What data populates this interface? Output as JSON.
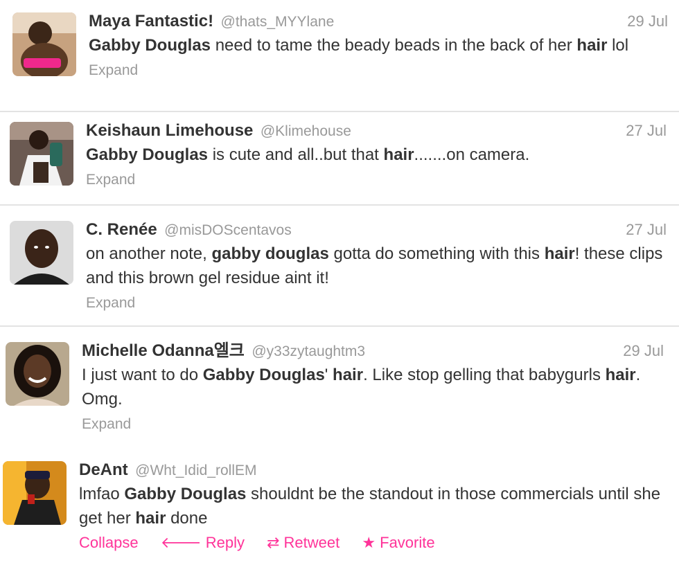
{
  "tweets": [
    {
      "name": "Maya Fantastic!",
      "handle": "@thats_MYYlane",
      "date": "29 Jul",
      "text_parts": [
        {
          "t": "Gabby Douglas",
          "b": true
        },
        {
          "t": " need to tame the beady beads in the back of her ",
          "b": false
        },
        {
          "t": "hair",
          "b": true
        },
        {
          "t": " lol",
          "b": false
        }
      ],
      "expand": "Expand"
    },
    {
      "name": "Keishaun Limehouse",
      "handle": "@Klimehouse",
      "date": "27 Jul",
      "text_parts": [
        {
          "t": "Gabby Douglas",
          "b": true
        },
        {
          "t": " is cute and all..but that ",
          "b": false
        },
        {
          "t": "hair",
          "b": true
        },
        {
          "t": ".......on camera.",
          "b": false
        }
      ],
      "expand": "Expand"
    },
    {
      "name": "C. Renée",
      "handle": "@misDOScentavos",
      "date": "27 Jul",
      "text_parts": [
        {
          "t": "on another note, ",
          "b": false
        },
        {
          "t": "gabby douglas",
          "b": true
        },
        {
          "t": " gotta do something with this ",
          "b": false
        },
        {
          "t": "hair",
          "b": true
        },
        {
          "t": "! these clips and this brown gel residue aint it!",
          "b": false
        }
      ],
      "expand": "Expand"
    },
    {
      "name": "Michelle Odanna엘크",
      "handle": "@y33zytaughtm3",
      "date": "29 Jul",
      "text_parts": [
        {
          "t": "I just want to do ",
          "b": false
        },
        {
          "t": "Gabby Douglas",
          "b": true
        },
        {
          "t": "' ",
          "b": false
        },
        {
          "t": "hair",
          "b": true
        },
        {
          "t": ". Like stop gelling that babygurls ",
          "b": false
        },
        {
          "t": "hair",
          "b": true
        },
        {
          "t": ". Omg.",
          "b": false
        }
      ],
      "expand": "Expand"
    },
    {
      "name": "DeAnt",
      "handle": "@Wht_Idid_rollEM",
      "date": "",
      "text_parts": [
        {
          "t": "lmfao ",
          "b": false
        },
        {
          "t": "Gabby Douglas",
          "b": true
        },
        {
          "t": " shouldnt be the standout in those commercials until she get her ",
          "b": false
        },
        {
          "t": "hair",
          "b": true
        },
        {
          "t": " done",
          "b": false
        }
      ],
      "actions": {
        "collapse": "Collapse",
        "reply": "Reply",
        "retweet": "Retweet",
        "favorite": "Favorite"
      }
    }
  ],
  "colors": {
    "link_pink": "#ff3399",
    "muted_gray": "#999999",
    "text": "#333333",
    "separator": "#e3e3e3"
  },
  "icons": {
    "reply": "reply-arrow-icon",
    "retweet": "retweet-icon",
    "favorite": "star-icon"
  }
}
